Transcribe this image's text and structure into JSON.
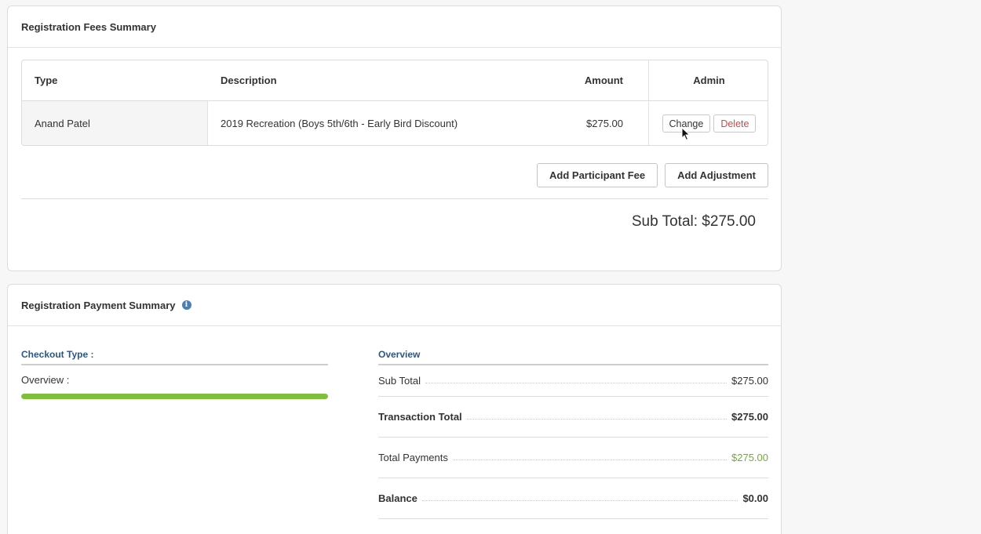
{
  "fees_panel": {
    "title": "Registration Fees Summary",
    "columns": [
      "Type",
      "Description",
      "Amount",
      "Admin"
    ],
    "rows": [
      {
        "type": "Anand Patel",
        "description": "2019 Recreation (Boys 5th/6th - Early Bird Discount)",
        "amount": "$275.00",
        "change_label": "Change",
        "delete_label": "Delete"
      }
    ],
    "add_participant_fee_label": "Add Participant Fee",
    "add_adjustment_label": "Add Adjustment",
    "subtotal": "Sub Total: $275.00"
  },
  "payment_panel": {
    "title": "Registration Payment Summary",
    "info_icon": "i",
    "checkout_type_label": "Checkout Type :",
    "overview_label": "Overview :",
    "progress_fraction": 1.0,
    "overview_heading": "Overview",
    "summary": [
      {
        "label": "Sub Total",
        "value": "$275.00",
        "bold": false,
        "green": false
      },
      {
        "label": "Transaction Total",
        "value": "$275.00",
        "bold": true,
        "green": false
      },
      {
        "label": "Total Payments",
        "value": "$275.00",
        "bold": false,
        "green": true
      },
      {
        "label": "Balance",
        "value": "$0.00",
        "bold": true,
        "green": false
      }
    ]
  },
  "colors": {
    "accent_blue": "#2a5788",
    "progress_green": "#7ebf3b",
    "delete_red": "#c94a4a",
    "payment_green": "#6fae38"
  }
}
